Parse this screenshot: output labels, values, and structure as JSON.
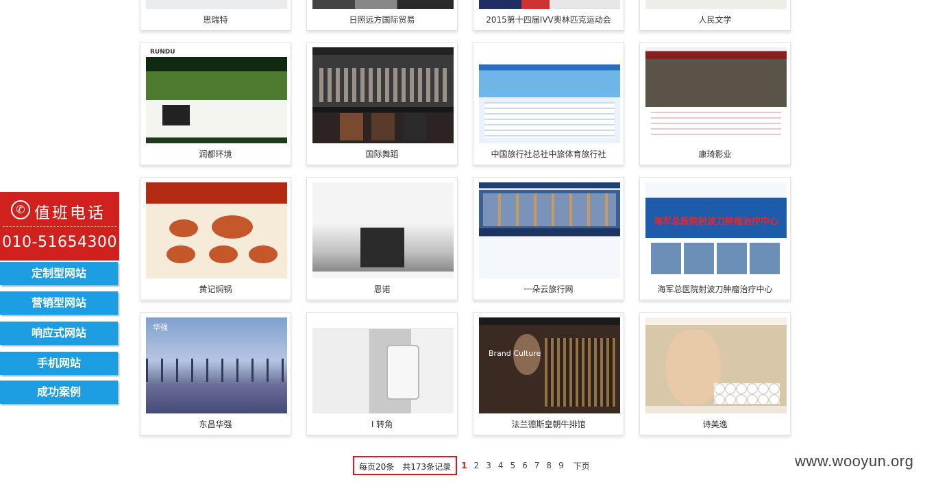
{
  "portfolio": {
    "items": [
      {
        "caption": "思瑞特"
      },
      {
        "caption": "日照远方国际贸易"
      },
      {
        "caption": "2015第十四届IVV奥林匹克运动会"
      },
      {
        "caption": "人民文学"
      },
      {
        "caption": "润都环境"
      },
      {
        "caption": "国际舞蹈"
      },
      {
        "caption": "中国旅行社总社中旅体育旅行社"
      },
      {
        "caption": "康琦影业"
      },
      {
        "caption": "黄记焖锅"
      },
      {
        "caption": "恩诺"
      },
      {
        "caption": "一朵云旅行网"
      },
      {
        "caption": "海军总医院射波刀肿瘤治疗中心"
      },
      {
        "caption": "东昌华强"
      },
      {
        "caption": "I 转角"
      },
      {
        "caption": "法兰德斯皇朝牛排馆"
      },
      {
        "caption": "诗美逸"
      }
    ],
    "thumb_text": {
      "rundu": "RUNDU",
      "navy": "海军总医院射波刀肿瘤治疗中心",
      "port": "华强",
      "steak": "Brand Culture"
    }
  },
  "side_panel": {
    "duty_title": "值班电话",
    "duty_phone": "010-51654300",
    "phone_icon": "✆",
    "buttons": [
      "定制型网站",
      "营销型网站",
      "响应式网站",
      "手机网站",
      "成功案例"
    ]
  },
  "pagination": {
    "per_page": "每页20条",
    "total": "共173条记录",
    "current": "1",
    "pages": [
      "2",
      "3",
      "4",
      "5",
      "6",
      "7",
      "8",
      "9"
    ],
    "next": "下页"
  },
  "watermark": "www.wooyun.org",
  "colors": {
    "duty_red": "#d0211e",
    "menu_blue": "#1d9ee2",
    "pager_border": "#e0141a"
  }
}
